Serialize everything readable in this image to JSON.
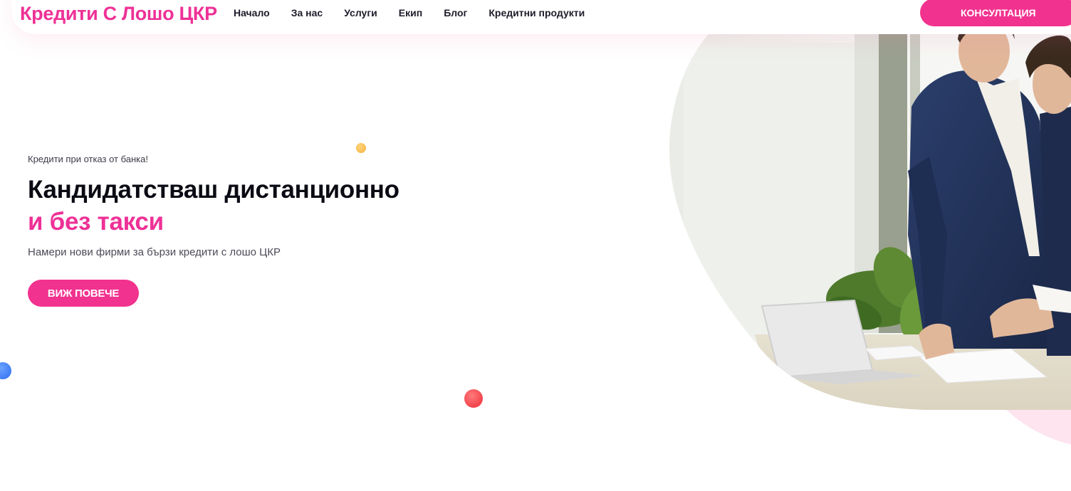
{
  "header": {
    "brand": "Кредити С Лошо ЦКР",
    "nav": [
      "Начало",
      "За нас",
      "Услуги",
      "Екип",
      "Блог",
      "Кредитни продукти"
    ],
    "cta": "КОНСУЛТАЦИЯ"
  },
  "hero": {
    "eyebrow": "Кредити при отказ от банка!",
    "headline": "Кандидатстваш дистанционно",
    "headline_accent": "и без такси",
    "subtitle": "Намери нови фирми за бързи кредити с лошо ЦКР",
    "cta": "ВИЖ ПОВЕЧЕ"
  },
  "colors": {
    "accent": "#f2328f",
    "brand_text": "#ee3196",
    "headline": "#0b0b14",
    "suit": "#22345e",
    "blob": "#fde4ef"
  },
  "icons": {
    "hero_image": "business-meeting-photo"
  }
}
